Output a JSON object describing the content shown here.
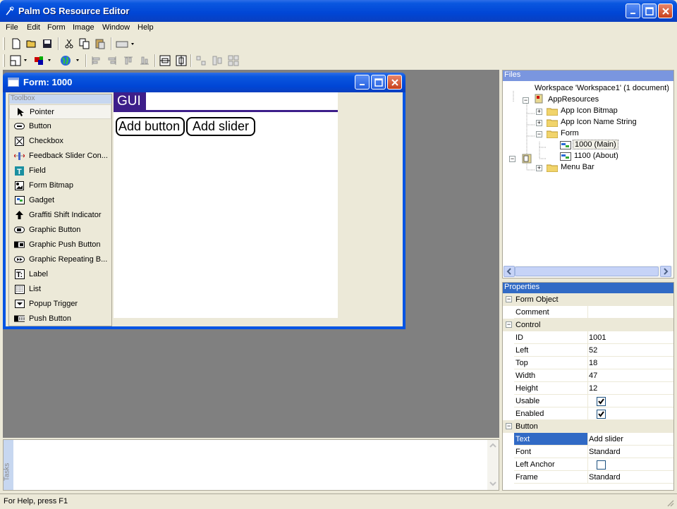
{
  "app": {
    "title": "Palm OS Resource Editor"
  },
  "menu": [
    "File",
    "Edit",
    "Form",
    "Image",
    "Window",
    "Help"
  ],
  "form_window": {
    "title": "Form: 1000"
  },
  "toolbox": {
    "title": "Toolbox",
    "items": [
      "Pointer",
      "Button",
      "Checkbox",
      "Feedback Slider Con...",
      "Field",
      "Form Bitmap",
      "Gadget",
      "Graffiti Shift Indicator",
      "Graphic Button",
      "Graphic Push Button",
      "Graphic Repeating B...",
      "Label",
      "List",
      "Popup Trigger",
      "Push Button"
    ]
  },
  "palm_form": {
    "title": "GUI",
    "buttons": [
      "Add button",
      "Add slider"
    ]
  },
  "files": {
    "title": "Files",
    "workspace": "Workspace 'Workspace1' (1 document)",
    "app_resources": "AppResources",
    "items": [
      "App Icon Bitmap",
      "App Icon Name String",
      "Form",
      "1000 (Main)",
      "1100 (About)",
      "Menu Bar"
    ]
  },
  "properties": {
    "title": "Properties",
    "sections": [
      "Form Object",
      "Control",
      "Button"
    ],
    "rows": [
      {
        "name": "Comment",
        "value": ""
      },
      {
        "name": "ID",
        "value": "1001"
      },
      {
        "name": "Left",
        "value": "52"
      },
      {
        "name": "Top",
        "value": "18"
      },
      {
        "name": "Width",
        "value": "47"
      },
      {
        "name": "Height",
        "value": "12"
      },
      {
        "name": "Usable",
        "value": ""
      },
      {
        "name": "Enabled",
        "value": ""
      },
      {
        "name": "Text",
        "value": "Add slider"
      },
      {
        "name": "Font",
        "value": "Standard"
      },
      {
        "name": "Left Anchor",
        "value": ""
      },
      {
        "name": "Frame",
        "value": "Standard"
      }
    ]
  },
  "tasks": {
    "label": "Tasks"
  },
  "status": {
    "text": "For Help, press F1"
  }
}
